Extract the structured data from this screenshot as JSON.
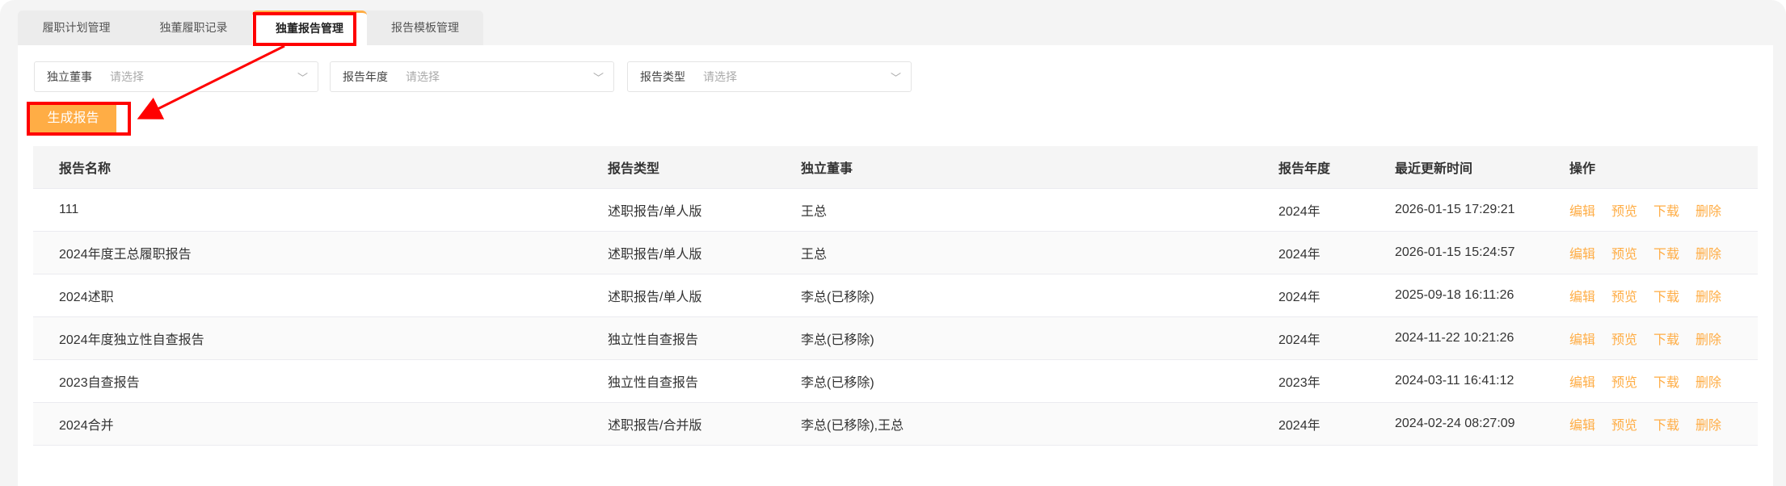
{
  "tabs": [
    {
      "label": "履职计划管理"
    },
    {
      "label": "独董履职记录"
    },
    {
      "label": "独董报告管理"
    },
    {
      "label": "报告模板管理"
    }
  ],
  "filters": [
    {
      "label": "独立董事",
      "placeholder": "请选择"
    },
    {
      "label": "报告年度",
      "placeholder": "请选择"
    },
    {
      "label": "报告类型",
      "placeholder": "请选择"
    }
  ],
  "generate_label": "生成报告",
  "table": {
    "headers": [
      "报告名称",
      "报告类型",
      "独立董事",
      "报告年度",
      "最近更新时间",
      "操作"
    ],
    "actions": [
      "编辑",
      "预览",
      "下载",
      "删除"
    ],
    "rows": [
      [
        "111",
        "述职报告/单人版",
        "王总",
        "2024年",
        "2026-01-15 17:29:21"
      ],
      [
        "2024年度王总履职报告",
        "述职报告/单人版",
        "王总",
        "2024年",
        "2026-01-15 15:24:57"
      ],
      [
        "2024述职",
        "述职报告/单人版",
        "李总(已移除)",
        "2024年",
        "2025-09-18 16:11:26"
      ],
      [
        "2024年度独立性自查报告",
        "独立性自查报告",
        "李总(已移除)",
        "2024年",
        "2024-11-22 10:21:26"
      ],
      [
        "2023自查报告",
        "独立性自查报告",
        "李总(已移除)",
        "2023年",
        "2024-03-11 16:41:12"
      ],
      [
        "2024合并",
        "述职报告/合并版",
        "李总(已移除),王总",
        "2024年",
        "2024-02-24 08:27:09"
      ]
    ]
  },
  "colors": {
    "accent": "#ffad45",
    "annotation": "#ff0000"
  }
}
